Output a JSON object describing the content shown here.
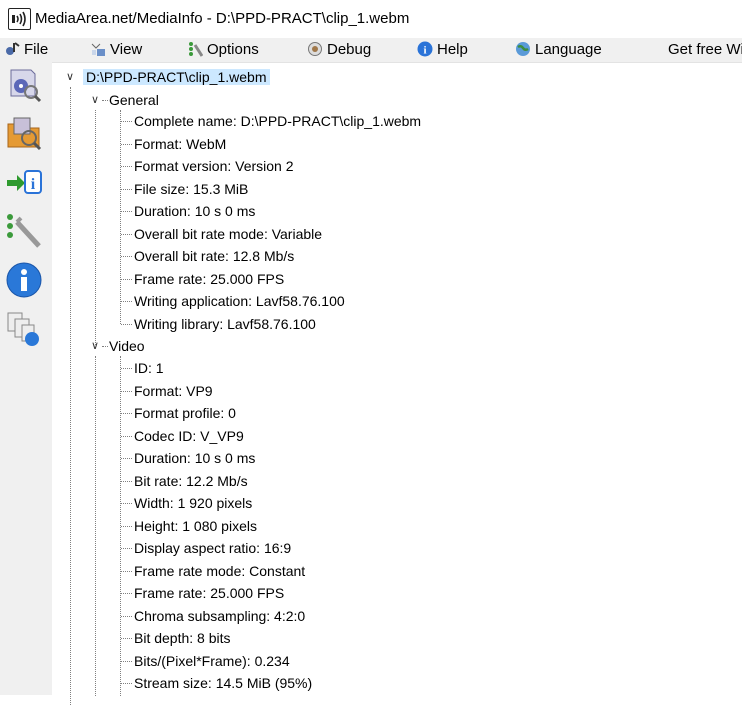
{
  "window": {
    "title": "MediaArea.net/MediaInfo - D:\\PPD-PRACT\\clip_1.webm"
  },
  "menu": [
    {
      "label": "File",
      "icon": "file-icon"
    },
    {
      "label": "View",
      "icon": "view-icon"
    },
    {
      "label": "Options",
      "icon": "options-icon"
    },
    {
      "label": "Debug",
      "icon": "debug-icon"
    },
    {
      "label": "Help",
      "icon": "help-icon"
    },
    {
      "label": "Language",
      "icon": "language-icon"
    },
    {
      "label": "Get free Wi",
      "icon": ""
    }
  ],
  "toolbar": [
    "open-file-icon",
    "open-folder-icon",
    "export-icon",
    "preferences-icon",
    "about-icon",
    "knowledge-base-icon"
  ],
  "tree": {
    "root": "D:\\PPD-PRACT\\clip_1.webm",
    "sections": [
      {
        "name": "General",
        "items": [
          "Complete name: D:\\PPD-PRACT\\clip_1.webm",
          "Format: WebM",
          "Format version: Version 2",
          "File size: 15.3 MiB",
          "Duration: 10 s 0 ms",
          "Overall bit rate mode: Variable",
          "Overall bit rate: 12.8 Mb/s",
          "Frame rate: 25.000 FPS",
          "Writing application: Lavf58.76.100",
          "Writing library: Lavf58.76.100"
        ]
      },
      {
        "name": "Video",
        "items": [
          "ID: 1",
          "Format: VP9",
          "Format profile: 0",
          "Codec ID: V_VP9",
          "Duration: 10 s 0 ms",
          "Bit rate: 12.2 Mb/s",
          "Width: 1 920 pixels",
          "Height: 1 080 pixels",
          "Display aspect ratio: 16:9",
          "Frame rate mode: Constant",
          "Frame rate: 25.000 FPS",
          "Chroma subsampling: 4:2:0",
          "Bit depth: 8 bits",
          "Bits/(Pixel*Frame): 0.234",
          "Stream size: 14.5 MiB (95%)"
        ]
      }
    ]
  }
}
